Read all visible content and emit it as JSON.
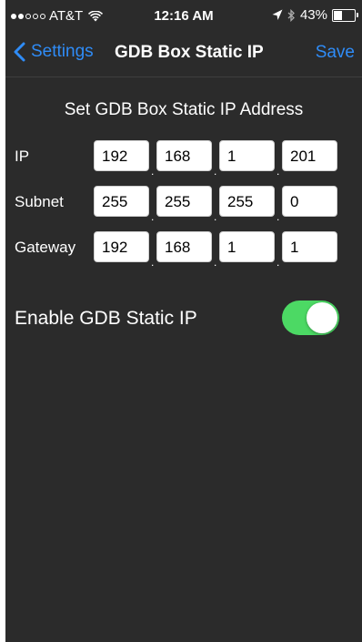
{
  "status_bar": {
    "carrier": "AT&T",
    "time": "12:16 AM",
    "battery": "43%",
    "battery_level": 0.43,
    "signal_bars_filled": 2,
    "signal_bars_total": 5,
    "icons": [
      "wifi-icon",
      "location-arrow-icon",
      "bluetooth-icon",
      "battery-icon"
    ]
  },
  "nav": {
    "back_label": "Settings",
    "title": "GDB Box Static IP",
    "save_label": "Save"
  },
  "form": {
    "section_title": "Set GDB Box Static IP Address",
    "rows": [
      {
        "label": "IP",
        "octets": [
          "192",
          "168",
          "1",
          "201"
        ]
      },
      {
        "label": "Subnet",
        "octets": [
          "255",
          "255",
          "255",
          "0"
        ]
      },
      {
        "label": "Gateway",
        "octets": [
          "192",
          "168",
          "1",
          "1"
        ]
      }
    ],
    "separator": "."
  },
  "toggle": {
    "label": "Enable GDB Static IP",
    "enabled": true
  },
  "colors": {
    "accent": "#2f8cf7",
    "background": "#2b2b2b",
    "toggle_on": "#4cd964"
  }
}
